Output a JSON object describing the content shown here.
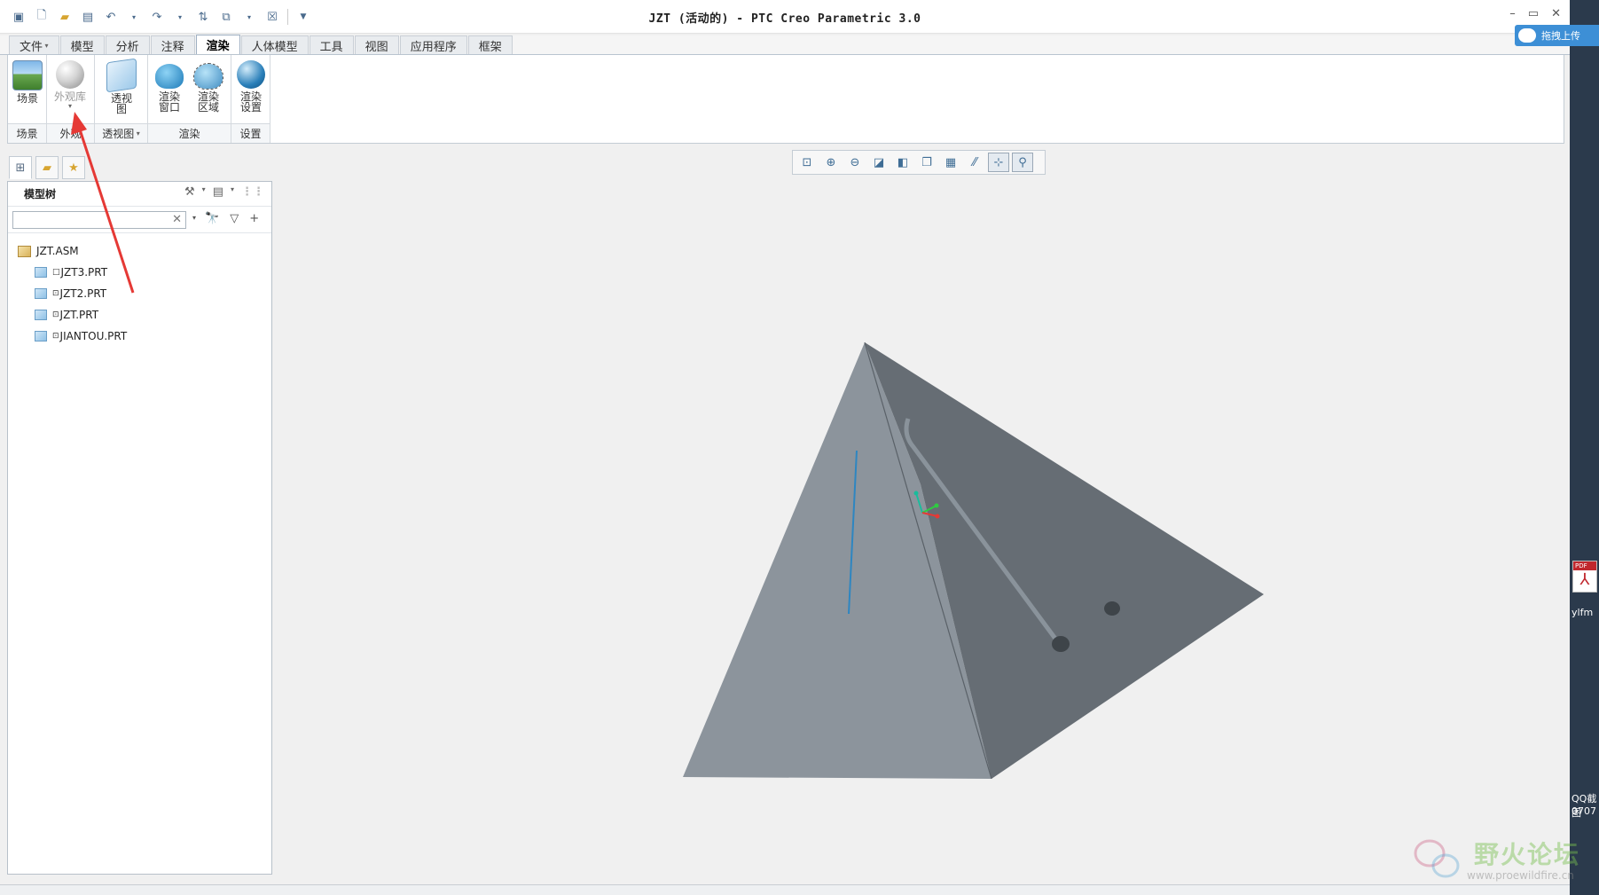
{
  "window": {
    "title": "JZT (活动的) - PTC Creo Parametric 3.0"
  },
  "ribbon_tabs": [
    "文件",
    "模型",
    "分析",
    "注释",
    "渲染",
    "人体模型",
    "工具",
    "视图",
    "应用程序",
    "框架"
  ],
  "active_tab": "渲染",
  "ribbon": {
    "scene_label": "场景",
    "appearance_label": "外观库",
    "perspective_label": "透视图",
    "render_window_label": "渲染窗口",
    "render_region_label": "渲染区域",
    "render_settings_label": "渲染设置",
    "groups": {
      "scene": "场景",
      "appearance": "外观",
      "perspective": "透视图",
      "render": "渲染",
      "settings": "设置"
    }
  },
  "model_tree": {
    "header": "模型树",
    "search_value": "",
    "root": "JZT.ASM",
    "items": [
      "JZT3.PRT",
      "JZT2.PRT",
      "JZT.PRT",
      "JIANTOU.PRT"
    ]
  },
  "desktop": {
    "upload_label": "拖拽上传",
    "pdf_badge": "PDF",
    "pdf_label": "ylfm",
    "shortcut_label_1": "QQ截图",
    "shortcut_label_2": "0707"
  },
  "watermark": {
    "title": "野火论坛",
    "url": "www.proewildfire.cn"
  },
  "colors": {
    "face_left": "#8c949c",
    "face_right": "#666d74",
    "highlight": "#2e86c1",
    "annotation_arrow": "#e53935"
  }
}
